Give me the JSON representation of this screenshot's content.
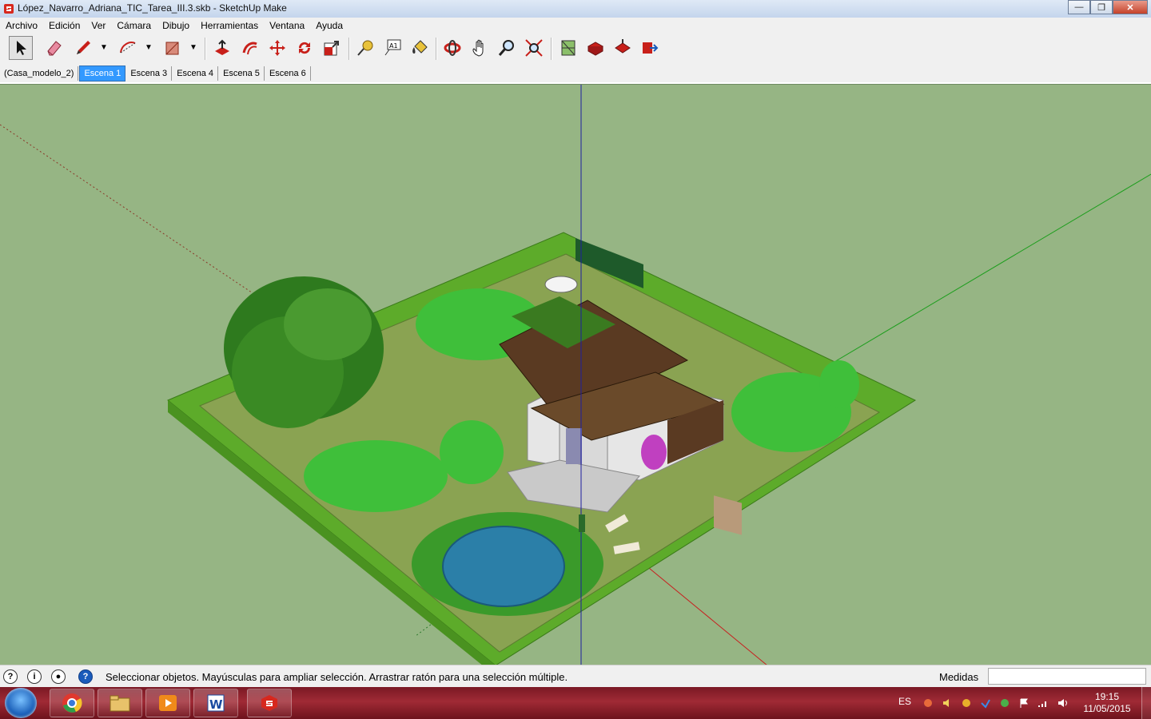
{
  "window": {
    "title": "López_Navarro_Adriana_TIC_Tarea_III.3.skb - SketchUp Make",
    "minimize_glyph": "—",
    "maximize_glyph": "❐",
    "close_glyph": "✕"
  },
  "menu": [
    "Archivo",
    "Edición",
    "Ver",
    "Cámara",
    "Dibujo",
    "Herramientas",
    "Ventana",
    "Ayuda"
  ],
  "toolbar": {
    "tools": [
      {
        "name": "select-tool",
        "icon": "arrow-cursor-icon"
      },
      {
        "name": "eraser-tool",
        "icon": "eraser-icon"
      },
      {
        "name": "line-tool",
        "icon": "pencil-icon"
      },
      {
        "name": "arc-tool",
        "icon": "arc-icon"
      },
      {
        "name": "rectangle-tool",
        "icon": "rectangle-icon"
      },
      {
        "name": "push-pull-tool",
        "icon": "push-pull-icon"
      },
      {
        "name": "offset-tool",
        "icon": "offset-icon"
      },
      {
        "name": "move-tool",
        "icon": "move-icon"
      },
      {
        "name": "rotate-tool",
        "icon": "rotate-icon"
      },
      {
        "name": "scale-tool",
        "icon": "scale-icon"
      },
      {
        "name": "tape-measure-tool",
        "icon": "tape-measure-icon"
      },
      {
        "name": "text-tool",
        "icon": "text-label-icon"
      },
      {
        "name": "paint-bucket-tool",
        "icon": "paint-bucket-icon"
      },
      {
        "name": "orbit-tool",
        "icon": "orbit-icon"
      },
      {
        "name": "pan-tool",
        "icon": "hand-icon"
      },
      {
        "name": "zoom-tool",
        "icon": "magnifier-icon"
      },
      {
        "name": "zoom-extents-tool",
        "icon": "zoom-extents-icon"
      },
      {
        "name": "warehouse-tool",
        "icon": "map-icon"
      },
      {
        "name": "get-models-tool",
        "icon": "3d-warehouse-icon"
      },
      {
        "name": "share-model-tool",
        "icon": "share-model-icon"
      },
      {
        "name": "extension-tool",
        "icon": "export-icon"
      }
    ],
    "text_tool_label": "A1"
  },
  "scene_tabs": [
    {
      "label": "(Casa_modelo_2)",
      "active": false
    },
    {
      "label": "Escena 1",
      "active": true
    },
    {
      "label": "Escena 3",
      "active": false
    },
    {
      "label": "Escena 4",
      "active": false
    },
    {
      "label": "Escena 5",
      "active": false
    },
    {
      "label": "Escena 6",
      "active": false
    }
  ],
  "status": {
    "message": "Seleccionar objetos. Mayúsculas para ampliar selección. Arrastrar ratón para una selección múltiple.",
    "measurements_label": "Medidas",
    "measurements_value": ""
  },
  "taskbar": {
    "apps": [
      "chrome-icon",
      "file-explorer-icon",
      "media-player-icon",
      "word-icon",
      "sketchup-icon"
    ],
    "language": "ES",
    "time": "19:15",
    "date": "11/05/2015"
  },
  "colors": {
    "viewport_bg": "#96b584",
    "active_tab": "#3399ff",
    "axis_red": "#c81e1e",
    "axis_green": "#1e9e1e",
    "axis_blue": "#1e1ea0",
    "hedge": "#5dab2a",
    "lawn": "#8aa352",
    "pool": "#2b7fa8",
    "roof": "#5a3a22"
  }
}
